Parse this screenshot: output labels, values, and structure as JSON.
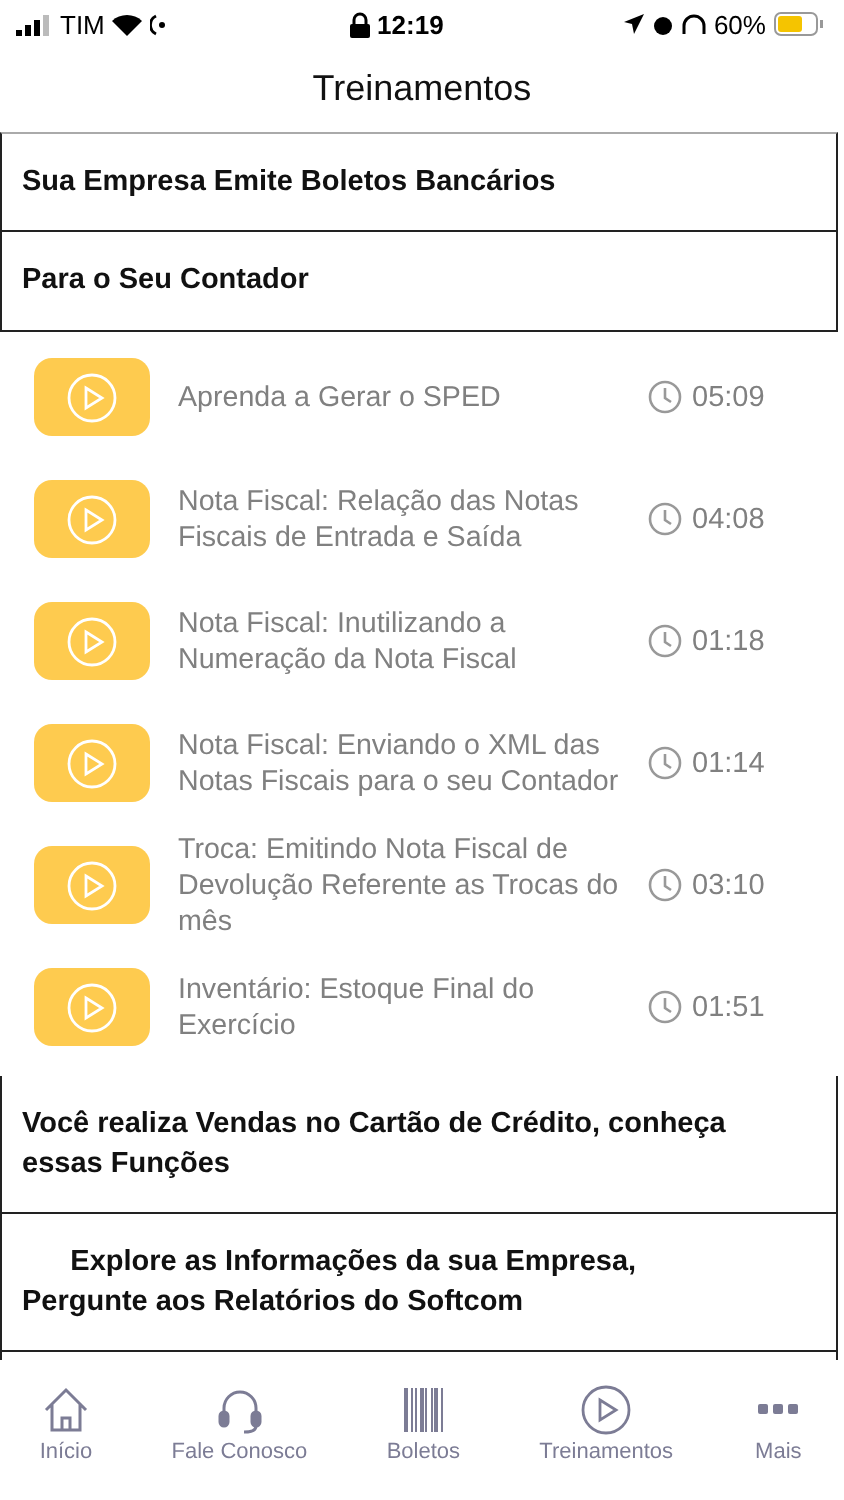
{
  "status_bar": {
    "carrier": "TIM",
    "time": "12:19",
    "battery": "60%"
  },
  "header": {
    "title": "Treinamentos"
  },
  "sections": [
    {
      "title": "Sua Empresa Emite Boletos Bancários"
    },
    {
      "title": "Para o Seu Contador",
      "videos": [
        {
          "title": "Aprenda a Gerar o SPED",
          "duration": "05:09"
        },
        {
          "title": "Nota Fiscal: Relação das Notas Fiscais de Entrada e Saída",
          "duration": "04:08"
        },
        {
          "title": "Nota Fiscal: Inutilizando a Numeração da Nota Fiscal",
          "duration": "01:18"
        },
        {
          "title": "Nota Fiscal: Enviando o XML das Notas Fiscais para o seu Contador",
          "duration": "01:14"
        },
        {
          "title": "Troca: Emitindo Nota Fiscal de Devolução Referente as Trocas do mês",
          "duration": "03:10"
        },
        {
          "title": "Inventário: Estoque Final do Exercício",
          "duration": "01:51"
        }
      ]
    },
    {
      "title": "Você realiza Vendas no Cartão de Crédito, conheça essas Funções"
    },
    {
      "title": "      Explore as Informações da sua Empresa, Pergunte aos Relatórios do Softcom"
    }
  ],
  "tab_bar": [
    {
      "label": "Início",
      "kind": "home"
    },
    {
      "label": "Fale Conosco",
      "kind": "headset"
    },
    {
      "label": "Boletos",
      "kind": "barcode"
    },
    {
      "label": "Treinamentos",
      "kind": "play"
    },
    {
      "label": "Mais",
      "kind": "more"
    }
  ]
}
